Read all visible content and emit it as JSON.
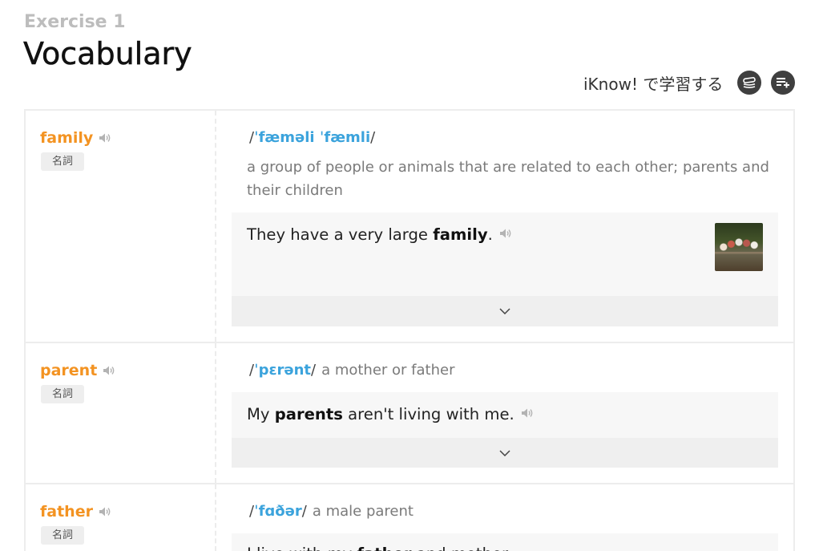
{
  "header": {
    "exercise_label": "Exercise 1",
    "title": "Vocabulary"
  },
  "study_link": {
    "label": "iKnow! で学習する",
    "icons": [
      "card-stack-icon",
      "playlist-add-icon"
    ]
  },
  "pronunciation_delimiter": "/",
  "icons": {
    "audio": "speaker-icon",
    "expand": "chevron-down-icon"
  },
  "colors": {
    "word": "#f39322",
    "pronunciation": "#3ba3dc",
    "definition": "#7a7a7a",
    "icon_circle": "#3f3f3f",
    "example_background": "#f7f7f7",
    "toggle_background": "#efefef"
  },
  "entries": [
    {
      "word": "family",
      "part_of_speech": "名詞",
      "pronunciation": "ˈfæməli ˈfæmli",
      "definition": "a group of people or animals that are related to each other; parents and their children",
      "example": {
        "before": "They have a very large ",
        "highlight": "family",
        "after": "."
      }
    },
    {
      "word": "parent",
      "part_of_speech": "名詞",
      "pronunciation": "ˈpɛrənt",
      "definition": "a mother or father",
      "example": {
        "before": "My ",
        "highlight": "parents",
        "after": " aren't living with me."
      }
    },
    {
      "word": "father",
      "part_of_speech": "名詞",
      "pronunciation": "ˈfɑðər",
      "definition": "a male parent",
      "example": {
        "before": "I live with my ",
        "highlight": "father",
        "after": " and mother."
      }
    }
  ]
}
